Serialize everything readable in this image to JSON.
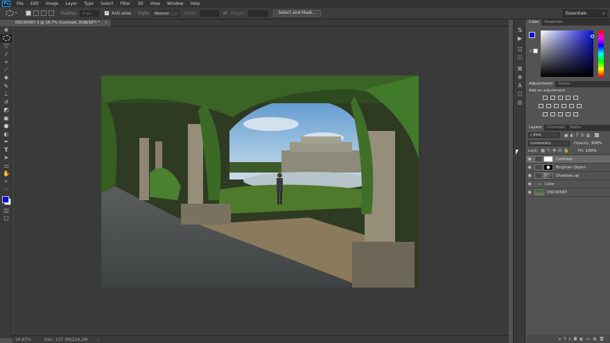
{
  "menu": {
    "logo": "Ps",
    "items": [
      "File",
      "Edit",
      "Image",
      "Layer",
      "Type",
      "Select",
      "Filter",
      "3D",
      "View",
      "Window",
      "Help"
    ]
  },
  "options": {
    "feather_label": "Feather:",
    "feather_value": "0 px",
    "antialias_label": "Anti-alias",
    "style_label": "Style:",
    "style_value": "Normal",
    "width_label": "Width:",
    "height_label": "Height:",
    "select_mask_button": "Select and Mask...",
    "workspace": "Essentials"
  },
  "document": {
    "tab_title": "DSC00587-3 @ 16.7% (Contrast, RGB/16*) *",
    "close_glyph": "×"
  },
  "status": {
    "zoom": "16.67%",
    "doc_info": "Doc: 137.3M/224.2M",
    "arrow": "›"
  },
  "colors": {
    "foreground": "#0a12d8",
    "background": "#ffffff",
    "accent": "#31a8ff"
  },
  "color_panel": {
    "tabs": [
      "Color",
      "Swatches"
    ]
  },
  "adjustments_panel": {
    "tabs": [
      "Adjustments",
      "Styles"
    ],
    "hint": "Add an adjustment"
  },
  "layers_panel": {
    "tabs": [
      "Layers",
      "Channels",
      "Paths"
    ],
    "kind_filter": "Kind",
    "blend_mode": "Luminosity",
    "opacity_label": "Opacity:",
    "opacity_value": "100%",
    "lock_label": "Lock:",
    "fill_label": "Fill:",
    "fill_value": "100%",
    "layers": [
      {
        "name": "Contrast",
        "type": "adjustment",
        "selected": true
      },
      {
        "name": "Brighten Object",
        "type": "adjustment",
        "selected": false
      },
      {
        "name": "Shadows up",
        "type": "adjustment",
        "selected": false
      },
      {
        "name": "Color",
        "type": "group",
        "selected": false
      },
      {
        "name": "DSC00587",
        "type": "pixel",
        "selected": false
      }
    ]
  },
  "icons": {
    "tools": [
      "move-icon",
      "marquee-icon",
      "lasso-icon",
      "quick-select-icon",
      "crop-icon",
      "eyedropper-icon",
      "healing-icon",
      "brush-icon",
      "stamp-icon",
      "history-brush-icon",
      "eraser-icon",
      "gradient-icon",
      "blur-icon",
      "dodge-icon",
      "pen-icon",
      "type-icon",
      "path-select-icon",
      "shape-icon",
      "hand-icon",
      "zoom-icon",
      "more-icon"
    ]
  }
}
